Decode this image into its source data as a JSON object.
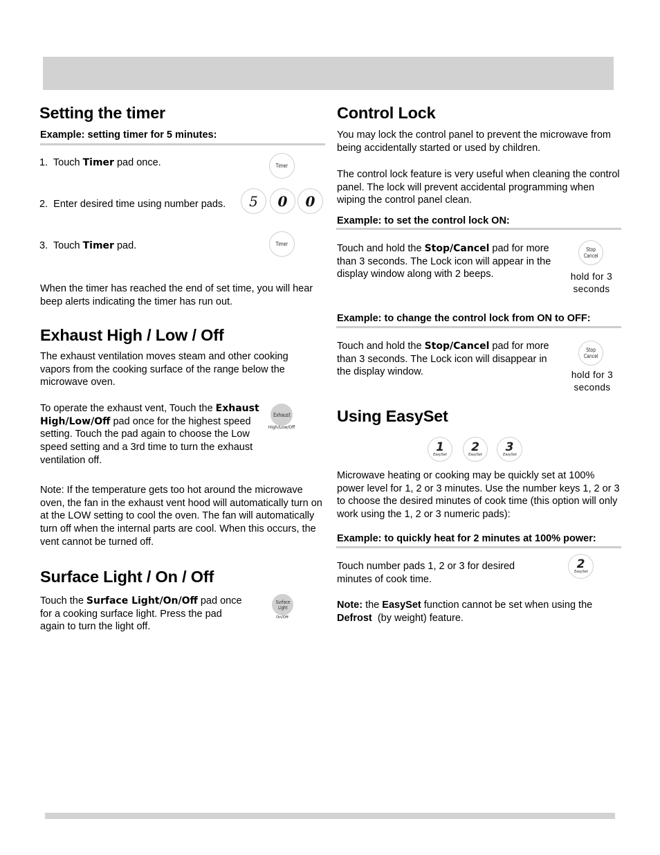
{
  "page": {
    "header_bar_color": "#d2d2d2",
    "rule_color": "#cdcdcd"
  },
  "timer": {
    "title": "Setting the timer",
    "example": "Example: setting timer for 5 minutes:",
    "steps": [
      {
        "num": "1.",
        "pre": "Touch ",
        "bold": "Timer",
        "post": " pad once."
      },
      {
        "num": "2.",
        "text": "Enter desired time using number pads."
      },
      {
        "num": "3.",
        "pre": "Touch ",
        "bold": "Timer",
        "post": " pad."
      }
    ],
    "pad_label": "Timer",
    "number_pads": [
      "5",
      "0",
      "0"
    ],
    "note": "When the timer has reached the end of set time, you will hear beep alerts indicating the timer has run out."
  },
  "exhaust": {
    "title": "Exhaust High / Low / Off",
    "intro": "The exhaust ventilation moves steam and other cooking vapors from the cooking surface of the range below the microwave oven.",
    "op_pre": "To operate the exhaust vent, Touch the ",
    "op_bold": "Exhaust High/Low/Off",
    "op_post": " pad once for the highest speed setting. Touch the pad again to choose the Low speed setting and a 3rd time to turn the exhaust ventilation off.",
    "pad_label": "Exhaust",
    "pad_sublabel": "High/Low/Off",
    "note": "Note: If the temperature gets too hot around the microwave oven, the fan in the exhaust vent hood will automatically turn on at the LOW setting to cool the oven. The fan will automatically turn off when the internal parts are cool. When this occurs, the vent cannot be turned off."
  },
  "surface_light": {
    "title": "Surface Light / On / Off",
    "pre": "Touch the ",
    "bold": "Surface Light/On/Off",
    "post": " pad once for a cooking surface light. Press the pad again to turn the light off.",
    "pad_label_1": "Surface",
    "pad_label_2": "Light",
    "pad_sublabel": "On/Off"
  },
  "control_lock": {
    "title": "Control Lock",
    "para1": "You may lock the control panel to prevent the microwave from being accidentally started or used by children.",
    "para2": "The control lock feature is very useful when cleaning the control panel. The lock will prevent accidental programming when wiping the control panel clean.",
    "example_on": "Example: to set the control lock ON:",
    "on_pre": "Touch and hold the ",
    "on_bold": "Stop/Cancel",
    "on_post": " pad for more than 3 seconds. The Lock icon will appear in the display window along with 2 beeps.",
    "example_off": "Example: to change the control lock from ON to OFF:",
    "off_pre": "Touch and hold the ",
    "off_bold": "Stop/Cancel",
    "off_post": " pad for more than 3 seconds. The Lock icon will disappear in the display window.",
    "pad_label_1": "Stop",
    "pad_label_2": "Cancel",
    "hold_line1": "hold for 3",
    "hold_line2": "seconds"
  },
  "easyset": {
    "title": "Using EasySet",
    "pads": [
      {
        "num": "1",
        "label": "EasySet"
      },
      {
        "num": "2",
        "label": "EasySet"
      },
      {
        "num": "3",
        "label": "EasySet"
      }
    ],
    "description": "Microwave heating or cooking may be quickly set at 100% power level for 1, 2 or 3 minutes. Use the number keys  1, 2 or 3 to choose the desired minutes of cook time (this option will only work using the 1, 2 or 3 numeric pads):",
    "example": "Example: to quickly heat for 2 minutes at 100% power:",
    "instruction": "Touch number pads 1, 2 or 3 for desired minutes of cook time.",
    "example_pad_num": "2",
    "example_pad_label": "EasySet",
    "note_label": "Note:",
    "note_pre": " the ",
    "note_bold1": "EasySet",
    "note_mid": " function cannot be set when using the ",
    "note_bold2": "Defrost",
    "note_post": "  (by weight) feature."
  }
}
